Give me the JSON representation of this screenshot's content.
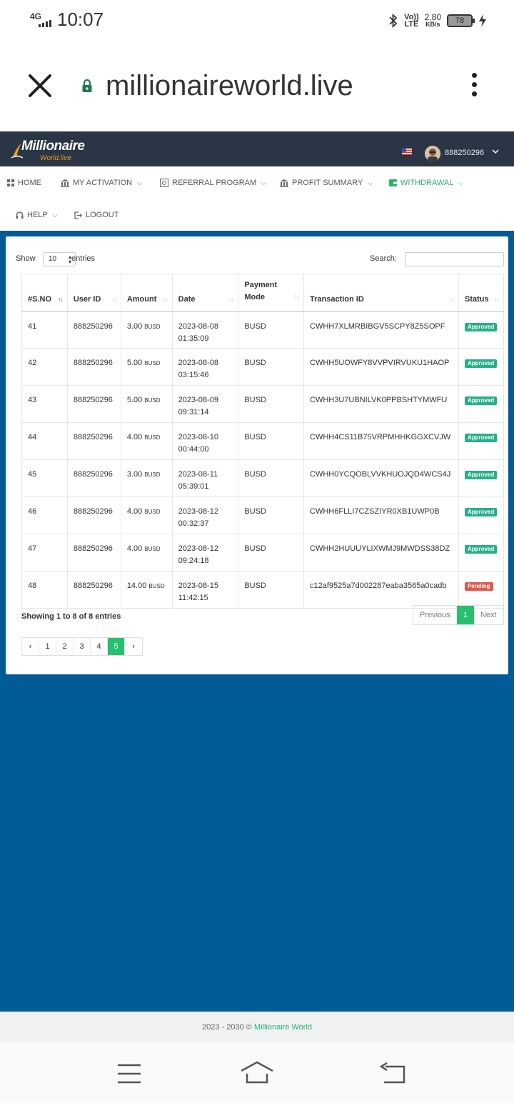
{
  "status_bar": {
    "network": "4G",
    "time": "10:07",
    "volte_line1": "Vo))",
    "volte_line2": "LTE",
    "speed": "2.80",
    "speed_unit": "KB/s",
    "battery": "78",
    "icons": [
      "signal-icon",
      "bluetooth-icon",
      "battery-icon",
      "charging-icon"
    ]
  },
  "browser": {
    "url": "millionaireworld.live",
    "icons": [
      "close-icon",
      "lock-icon",
      "more-vert-icon"
    ]
  },
  "site_header": {
    "logo_line1": "Millionaire",
    "logo_line2": "World.live",
    "username": "888250296",
    "flag": "us-flag-icon"
  },
  "menu": {
    "home": "HOME",
    "activation": "MY ACTIVATION",
    "referral": "REFERRAL PROGRAM",
    "profit": "PROFIT SUMMARY",
    "withdrawal": "WITHDRAWAL",
    "help": "HELP",
    "logout": "LOGOUT",
    "active_color": "#26b36a"
  },
  "table_controls": {
    "show_label": "Show",
    "entries_value": "10",
    "entries_label": "entries",
    "search_label": "Search:"
  },
  "table": {
    "headers": [
      "#S.NO",
      "User ID",
      "Amount",
      "Date",
      "Payment Mode",
      "Transaction ID",
      "Status"
    ],
    "rows": [
      {
        "sno": "41",
        "user": "888250296",
        "amount": "3.00",
        "unit": "BUSD",
        "date": "2023-08-08",
        "time": "01:35:09",
        "mode": "BUSD",
        "txid": "CWHH7XLMRBIBGV5SCPY8Z5SOPF",
        "status": "Approved",
        "status_color": "#26b08a"
      },
      {
        "sno": "42",
        "user": "888250296",
        "amount": "5.00",
        "unit": "BUSD",
        "date": "2023-08-08",
        "time": "03:15:46",
        "mode": "BUSD",
        "txid": "CWHH5UOWFY8VVPVIRVUKU1HAOP",
        "status": "Approved",
        "status_color": "#26b08a"
      },
      {
        "sno": "43",
        "user": "888250296",
        "amount": "5.00",
        "unit": "BUSD",
        "date": "2023-08-09",
        "time": "09:31:14",
        "mode": "BUSD",
        "txid": "CWHH3U7UBNILVK0PPBSHTYMWFU",
        "status": "Approved",
        "status_color": "#26b08a"
      },
      {
        "sno": "44",
        "user": "888250296",
        "amount": "4.00",
        "unit": "BUSD",
        "date": "2023-08-10",
        "time": "00:44:00",
        "mode": "BUSD",
        "txid": "CWHH4CS11B75VRPMHHKGGXCVJW",
        "status": "Approved",
        "status_color": "#26b08a"
      },
      {
        "sno": "45",
        "user": "888250296",
        "amount": "3.00",
        "unit": "BUSD",
        "date": "2023-08-11",
        "time": "05:39:01",
        "mode": "BUSD",
        "txid": "CWHH0YCQOBLVVKHUOJQD4WCS4J",
        "status": "Approved",
        "status_color": "#26b08a"
      },
      {
        "sno": "46",
        "user": "888250296",
        "amount": "4.00",
        "unit": "BUSD",
        "date": "2023-08-12",
        "time": "00:32:37",
        "mode": "BUSD",
        "txid": "CWHH6FLLI7CZSZIYR0XB1UWP0B",
        "status": "Approved",
        "status_color": "#26b08a"
      },
      {
        "sno": "47",
        "user": "888250296",
        "amount": "4.00",
        "unit": "BUSD",
        "date": "2023-08-12",
        "time": "09:24:18",
        "mode": "BUSD",
        "txid": "CWHH2HUUUYLIXWMJ9MWDSS38DZ",
        "status": "Approved",
        "status_color": "#26b08a"
      },
      {
        "sno": "48",
        "user": "888250296",
        "amount": "14.00",
        "unit": "BUSD",
        "date": "2023-08-15",
        "time": "11:42:15",
        "mode": "BUSD",
        "txid": "c12af9525a7d002287eaba3565a0cadb",
        "status": "Pending",
        "status_color": "#e05a4b"
      }
    ]
  },
  "table_footer": {
    "info": "Showing 1 to 8 of 8 entries",
    "previous": "Previous",
    "current": "1",
    "next": "Next"
  },
  "pagination": {
    "prev": "‹",
    "pages": [
      "1",
      "2",
      "3",
      "4",
      "5"
    ],
    "active": "5",
    "next": "›"
  },
  "footer": {
    "text": "2023 - 2030 ©",
    "brand": "Millionaire World"
  },
  "system_nav": [
    "menu-icon",
    "home-icon",
    "back-icon"
  ]
}
